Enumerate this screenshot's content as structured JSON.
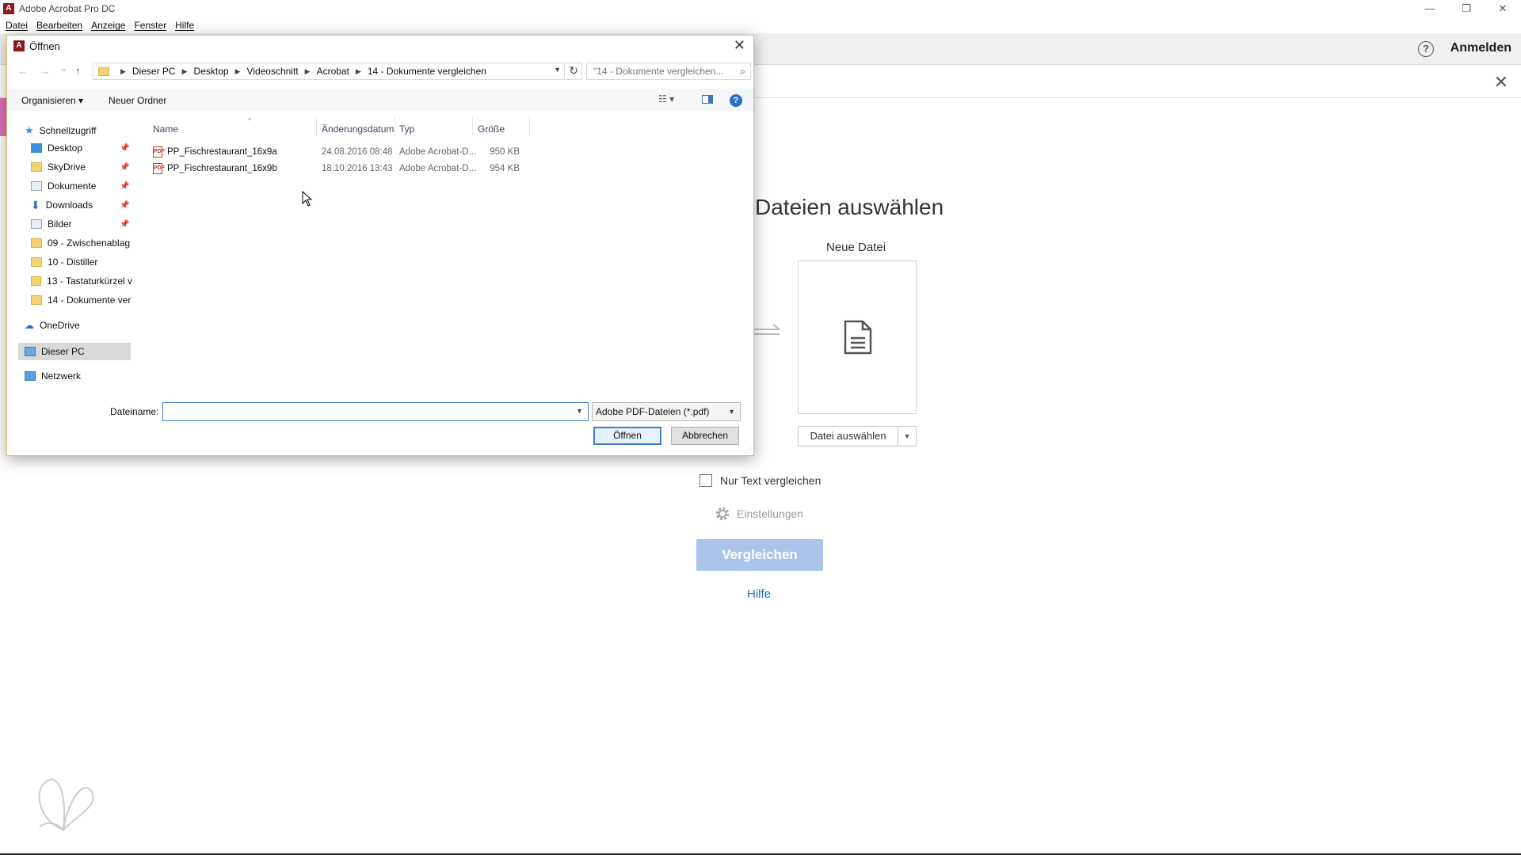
{
  "app": {
    "window_title": "Adobe Acrobat Pro DC",
    "icon_letter": "A",
    "window_controls": {
      "minimize": "—",
      "restore": "❐",
      "close": "✕"
    }
  },
  "menubar": [
    "Datei",
    "Bearbeiten",
    "Anzeige",
    "Fenster",
    "Hilfe"
  ],
  "header": {
    "help_icon": "?",
    "sign_in": "Anmelden",
    "close": "✕"
  },
  "compare": {
    "title": "Dateien auswählen",
    "new_file_label": "Neue Datei",
    "select_file_button": "Datei auswählen",
    "select_file_caret": "▼",
    "text_only_label": "Nur Text vergleichen",
    "settings_label": "Einstellungen",
    "compare_button": "Vergleichen",
    "help_link": "Hilfe"
  },
  "dialog": {
    "title": "Öffnen",
    "close": "✕",
    "nav": {
      "back": "←",
      "forward": "→",
      "recent": "⌄",
      "up": "↑"
    },
    "breadcrumb": [
      "Dieser PC",
      "Desktop",
      "Videoschnitt",
      "Acrobat",
      "14 - Dokumente vergleichen"
    ],
    "breadcrumb_sep": "▶",
    "address_dropdown": "▼",
    "refresh": "↻",
    "search_placeholder": "\"14 - Dokumente vergleichen...",
    "search_icon": "⌕",
    "organize": "Organisieren ▾",
    "new_folder": "Neuer Ordner",
    "view_icon": "☷ ▾",
    "help": "?",
    "nav_pane": {
      "quick_access": "Schnellzugriff",
      "quick_items": [
        {
          "label": "Desktop",
          "icon": "desktop-icon",
          "pinned": true
        },
        {
          "label": "SkyDrive",
          "icon": "folder-icon",
          "pinned": true
        },
        {
          "label": "Dokumente",
          "icon": "documents-icon",
          "pinned": true
        },
        {
          "label": "Downloads",
          "icon": "download-icon",
          "pinned": true
        },
        {
          "label": "Bilder",
          "icon": "pictures-icon",
          "pinned": true
        },
        {
          "label": "09 - Zwischenablag",
          "icon": "folder-icon",
          "pinned": false
        },
        {
          "label": "10 - Distiller",
          "icon": "folder-icon",
          "pinned": false
        },
        {
          "label": "13 - Tastaturkürzel v",
          "icon": "folder-icon",
          "pinned": false
        },
        {
          "label": "14 - Dokumente ver",
          "icon": "folder-icon",
          "pinned": false
        }
      ],
      "pin_glyph": "📌",
      "onedrive": "OneDrive",
      "this_pc": "Dieser PC",
      "network": "Netzwerk"
    },
    "columns": [
      "Name",
      "Änderungsdatum",
      "Typ",
      "Größe"
    ],
    "sort_caret": "^",
    "files": [
      {
        "name": "PP_Fischrestaurant_16x9a",
        "date": "24.08.2016 08:48",
        "type": "Adobe Acrobat-D...",
        "size": "950 KB"
      },
      {
        "name": "PP_Fischrestaurant_16x9b",
        "date": "18.10.2016 13:43",
        "type": "Adobe Acrobat-D...",
        "size": "954 KB"
      }
    ],
    "pdf_icon_label": "PDF",
    "filename_label": "Dateiname:",
    "filename_value": "",
    "filename_dropdown": "▼",
    "filter": "Adobe PDF-Dateien (*.pdf)",
    "filter_dropdown": "▼",
    "open_button": "Öffnen",
    "cancel_button": "Abbrechen",
    "resize_grip": "⋰"
  },
  "colors": {
    "accent": "#3c7fd0",
    "compare_button_bg": "#a9c6ea",
    "help_link": "#1f6fbf",
    "pdf_red": "#cc3333"
  }
}
